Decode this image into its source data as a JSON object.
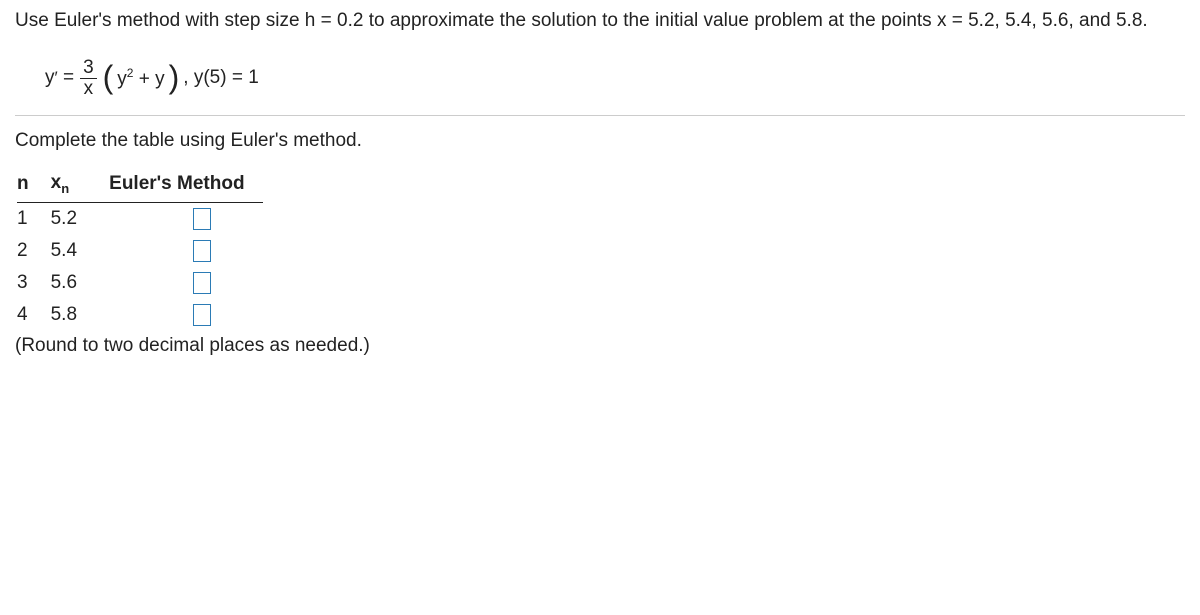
{
  "problem": {
    "line1": "Use Euler's method with step size h = 0.2 to approximate the solution to the initial value problem at the points x = 5.2, 5.4, 5.6, and 5.8.",
    "eq_lhs": "y′ = ",
    "frac_num": "3",
    "frac_den": "x",
    "eq_rhs_1": "y",
    "eq_rhs_sup": "2",
    "eq_rhs_2": " + y",
    "eq_tail": ", y(5) = 1"
  },
  "instruction": "Complete the table using Euler's method.",
  "table": {
    "headers": {
      "n": "n",
      "xn_base": "x",
      "xn_sub": "n",
      "em": "Euler's Method"
    },
    "rows": [
      {
        "n": "1",
        "xn": "5.2"
      },
      {
        "n": "2",
        "xn": "5.4"
      },
      {
        "n": "3",
        "xn": "5.6"
      },
      {
        "n": "4",
        "xn": "5.8"
      }
    ]
  },
  "round_note": "(Round to two decimal places as needed.)"
}
